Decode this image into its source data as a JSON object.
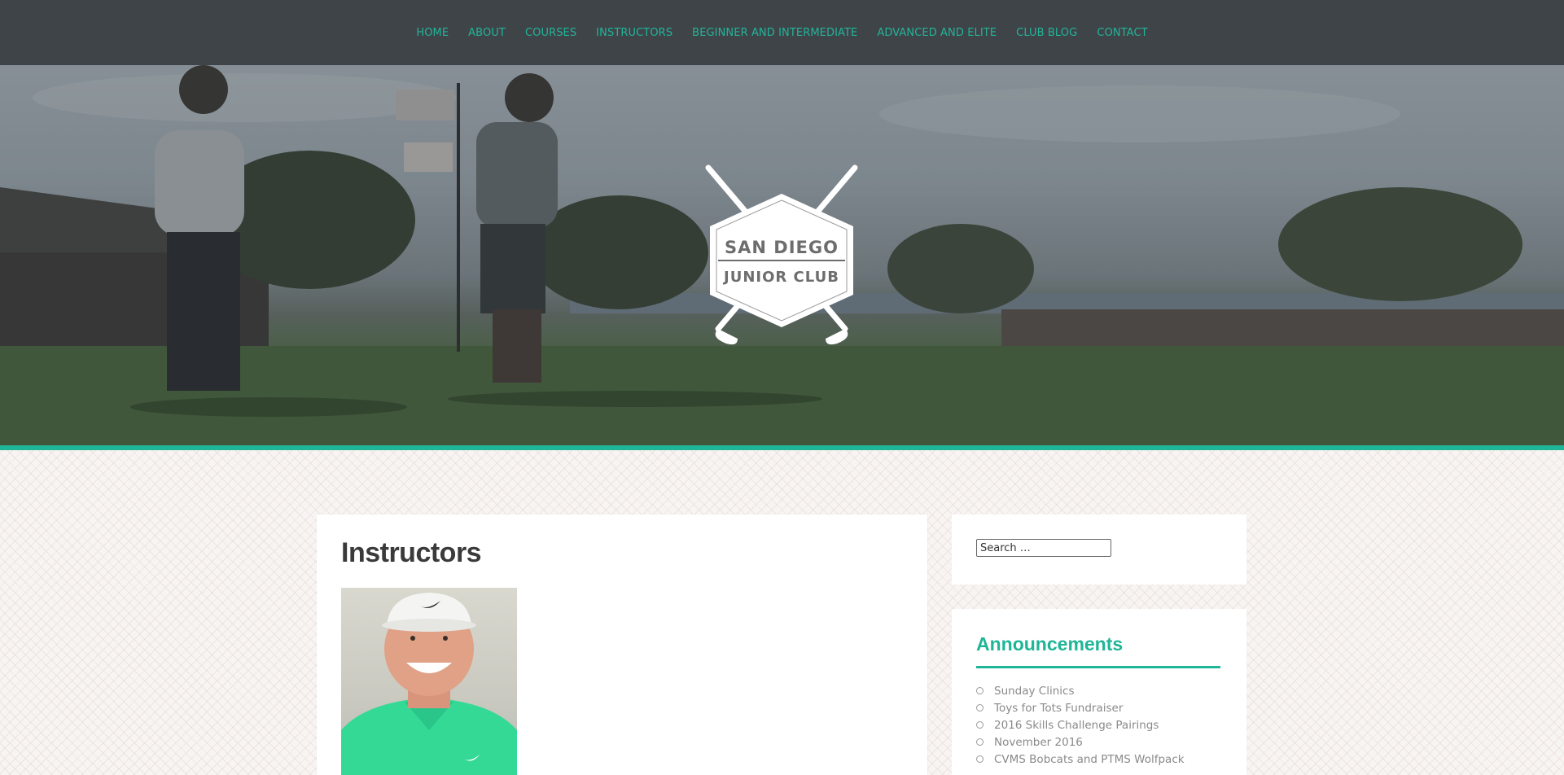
{
  "nav": {
    "items": [
      {
        "label": "HOME"
      },
      {
        "label": "ABOUT"
      },
      {
        "label": "COURSES"
      },
      {
        "label": "INSTRUCTORS"
      },
      {
        "label": "BEGINNER AND INTERMEDIATE"
      },
      {
        "label": "ADVANCED AND ELITE"
      },
      {
        "label": "CLUB BLOG"
      },
      {
        "label": "CONTACT"
      }
    ]
  },
  "logo": {
    "line1": "SAN DIEGO",
    "line2": "JUNIOR CLUB"
  },
  "main": {
    "title": "Instructors"
  },
  "sidebar": {
    "search_placeholder": "Search …",
    "announcements": {
      "title": "Announcements",
      "items": [
        {
          "label": "Sunday Clinics"
        },
        {
          "label": "Toys for Tots Fundraiser"
        },
        {
          "label": "2016 Skills Challenge Pairings"
        },
        {
          "label": "November 2016"
        },
        {
          "label": "CVMS Bobcats and PTMS Wolfpack"
        }
      ]
    }
  },
  "colors": {
    "accent": "#1fb597",
    "nav_bg": "#3f4448"
  }
}
